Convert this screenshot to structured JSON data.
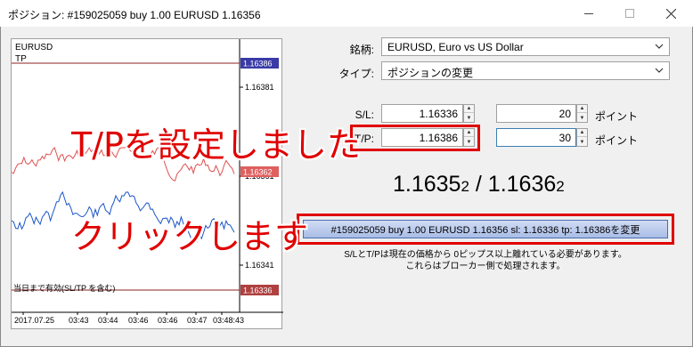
{
  "window": {
    "title": "ポジション: #159025059 buy 1.00 EURUSD 1.16356"
  },
  "chart": {
    "symbol": "EURUSD",
    "tp_label": "TP",
    "footer_label": "当日まで有効(SL/TP を含む)",
    "price_ticks": [
      "1.16381",
      "1.16361",
      "1.16341"
    ],
    "price_tags": [
      {
        "value": "1.16386",
        "color": "#3a3aa8"
      },
      {
        "value": "1.16362",
        "color": "#e06060"
      },
      {
        "value": "1.16336",
        "color": "#b04040"
      }
    ],
    "time_labels": [
      "2017.07.25",
      "03:43",
      "03:44",
      "03:46",
      "03:46",
      "03:47",
      "03:48:43"
    ]
  },
  "form": {
    "symbol_label": "銘柄:",
    "symbol_value": "EURUSD, Euro vs US Dollar",
    "type_label": "タイプ:",
    "type_value": "ポジションの変更",
    "sl_label": "S/L:",
    "sl_value": "1.16336",
    "sl_points": "20",
    "tp_label": "T/P:",
    "tp_value": "1.16386",
    "tp_points": "30",
    "points_unit": "ポイント",
    "bid_main": "1.1635",
    "bid_small": "2",
    "separator": "/",
    "ask_main": "1.1636",
    "ask_small": "2",
    "modify_button": "#159025059 buy 1.00 EURUSD 1.16356 sl: 1.16336 tp: 1.16386を変更",
    "note_line1": "S/LとT/Pは現在の価格から 0ピップス以上離れている必要があります。",
    "note_line2": "これらはブローカー側で処理されます。"
  },
  "annotations": {
    "tp_set": "T/Pを設定しました",
    "click": "クリックします",
    "color": "#e00000"
  }
}
